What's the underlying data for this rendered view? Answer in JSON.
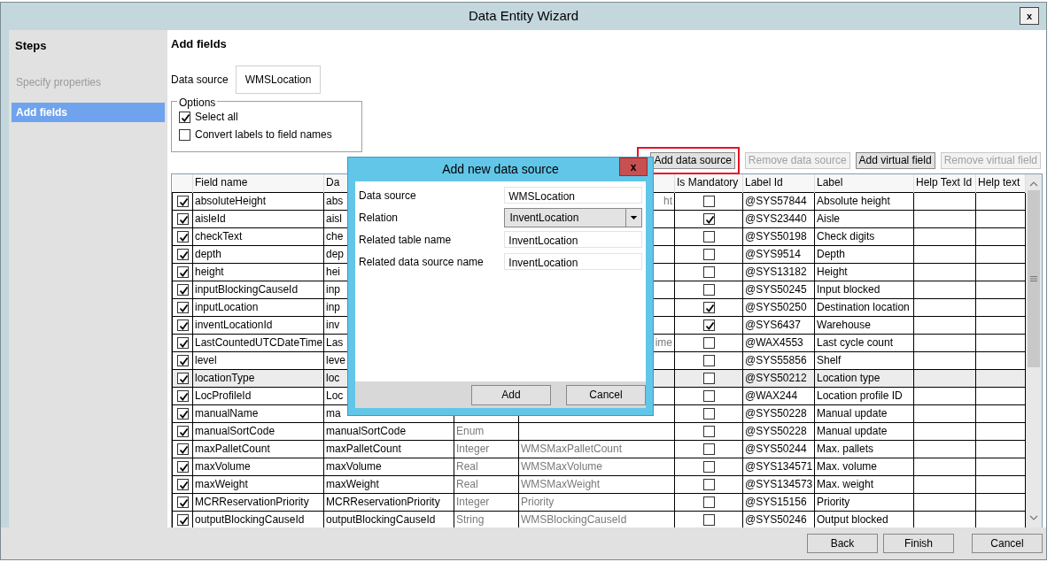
{
  "window": {
    "title": "Data Entity Wizard",
    "close_label": "x"
  },
  "steps": {
    "title": "Steps",
    "items": [
      {
        "label": "Specify properties",
        "selected": false
      },
      {
        "label": "Add fields",
        "selected": true
      }
    ]
  },
  "page": {
    "title": "Add fields",
    "data_source_label": "Data source",
    "data_source_value": "WMSLocation",
    "options": {
      "legend": "Options",
      "items": [
        {
          "label": "Select all",
          "checked": true
        },
        {
          "label": "Convert labels to field names",
          "checked": false
        }
      ]
    }
  },
  "toolbar": [
    {
      "label": "Add data source",
      "disabled": false,
      "highlighted": true
    },
    {
      "label": "Remove data source",
      "disabled": true,
      "highlighted": false
    },
    {
      "label": "Add virtual field",
      "disabled": false,
      "highlighted": false
    },
    {
      "label": "Remove virtual field",
      "disabled": true,
      "highlighted": false
    }
  ],
  "table": {
    "columns": [
      "Field name",
      "Da",
      "Is Mandatory",
      "Label Id",
      "Label",
      "Help Text Id",
      "Help text"
    ],
    "rows": [
      {
        "checked": true,
        "field_name": "absoluteHeight",
        "data_field": "abs",
        "edt_tail": "ht",
        "mandatory": false,
        "label_id": "@SYS57844",
        "label": "Absolute height",
        "selected": false
      },
      {
        "checked": true,
        "field_name": "aisleId",
        "data_field": "aisl",
        "mandatory": true,
        "label_id": "@SYS23440",
        "label": "Aisle",
        "selected": false
      },
      {
        "checked": true,
        "field_name": "checkText",
        "data_field": "che",
        "mandatory": false,
        "label_id": "@SYS50198",
        "label": "Check digits",
        "selected": false
      },
      {
        "checked": true,
        "field_name": "depth",
        "data_field": "dep",
        "mandatory": false,
        "label_id": "@SYS9514",
        "label": "Depth",
        "selected": false
      },
      {
        "checked": true,
        "field_name": "height",
        "data_field": "hei",
        "mandatory": false,
        "label_id": "@SYS13182",
        "label": "Height",
        "selected": false
      },
      {
        "checked": true,
        "field_name": "inputBlockingCauseId",
        "data_field": "inp",
        "mandatory": false,
        "label_id": "@SYS50245",
        "label": "Input blocked",
        "selected": false
      },
      {
        "checked": true,
        "field_name": "inputLocation",
        "data_field": "inp",
        "mandatory": true,
        "label_id": "@SYS50250",
        "label": "Destination location",
        "selected": false
      },
      {
        "checked": true,
        "field_name": "inventLocationId",
        "data_field": "inv",
        "mandatory": true,
        "label_id": "@SYS6437",
        "label": "Warehouse",
        "selected": false
      },
      {
        "checked": true,
        "field_name": "LastCountedUTCDateTime",
        "data_field": "Las",
        "edt_tail": "ime",
        "mandatory": false,
        "label_id": "@WAX4553",
        "label": "Last cycle count",
        "selected": false
      },
      {
        "checked": true,
        "field_name": "level",
        "data_field": "leve",
        "mandatory": false,
        "label_id": "@SYS55856",
        "label": "Shelf",
        "selected": false
      },
      {
        "checked": true,
        "field_name": "locationType",
        "data_field": "loc",
        "mandatory": false,
        "label_id": "@SYS50212",
        "label": "Location type",
        "selected": true
      },
      {
        "checked": true,
        "field_name": "LocProfileId",
        "data_field": "Loc",
        "mandatory": false,
        "label_id": "@WAX244",
        "label": "Location profile ID",
        "selected": false
      },
      {
        "checked": true,
        "field_name": "manualName",
        "data_field": "ma",
        "mandatory": false,
        "label_id": "@SYS50228",
        "label": "Manual update",
        "selected": false
      },
      {
        "checked": true,
        "field_name": "manualSortCode",
        "data_field": "manualSortCode",
        "type": "Enum",
        "mandatory": false,
        "label_id": "@SYS50228",
        "label": "Manual update",
        "selected": false
      },
      {
        "checked": true,
        "field_name": "maxPalletCount",
        "data_field": "maxPalletCount",
        "type": "Integer",
        "edt": "WMSMaxPalletCount",
        "mandatory": false,
        "label_id": "@SYS50244",
        "label": "Max. pallets",
        "selected": false
      },
      {
        "checked": true,
        "field_name": "maxVolume",
        "data_field": "maxVolume",
        "type": "Real",
        "edt": "WMSMaxVolume",
        "mandatory": false,
        "label_id": "@SYS134571",
        "label": "Max. volume",
        "selected": false
      },
      {
        "checked": true,
        "field_name": "maxWeight",
        "data_field": "maxWeight",
        "type": "Real",
        "edt": "WMSMaxWeight",
        "mandatory": false,
        "label_id": "@SYS134573",
        "label": "Max. weight",
        "selected": false
      },
      {
        "checked": true,
        "field_name": "MCRReservationPriority",
        "data_field": "MCRReservationPriority",
        "type": "Integer",
        "edt": "Priority",
        "mandatory": false,
        "label_id": "@SYS15156",
        "label": "Priority",
        "selected": false
      },
      {
        "checked": true,
        "field_name": "outputBlockingCauseId",
        "data_field": "outputBlockingCauseId",
        "type": "String",
        "edt": "WMSBlockingCauseId",
        "mandatory": false,
        "label_id": "@SYS50246",
        "label": "Output blocked",
        "selected": false
      }
    ]
  },
  "dialog": {
    "title": "Add new data source",
    "close_label": "x",
    "fields": [
      {
        "kind": "text",
        "label": "Data source",
        "value": "WMSLocation"
      },
      {
        "kind": "dropdown",
        "label": "Relation",
        "value": "InventLocation"
      },
      {
        "kind": "text",
        "label": "Related table name",
        "value": "InventLocation"
      },
      {
        "kind": "text",
        "label": "Related data source name",
        "value": "InventLocation"
      }
    ],
    "buttons": [
      "Add",
      "Cancel"
    ]
  },
  "footer_buttons": [
    "Back",
    "Finish",
    "Cancel"
  ]
}
